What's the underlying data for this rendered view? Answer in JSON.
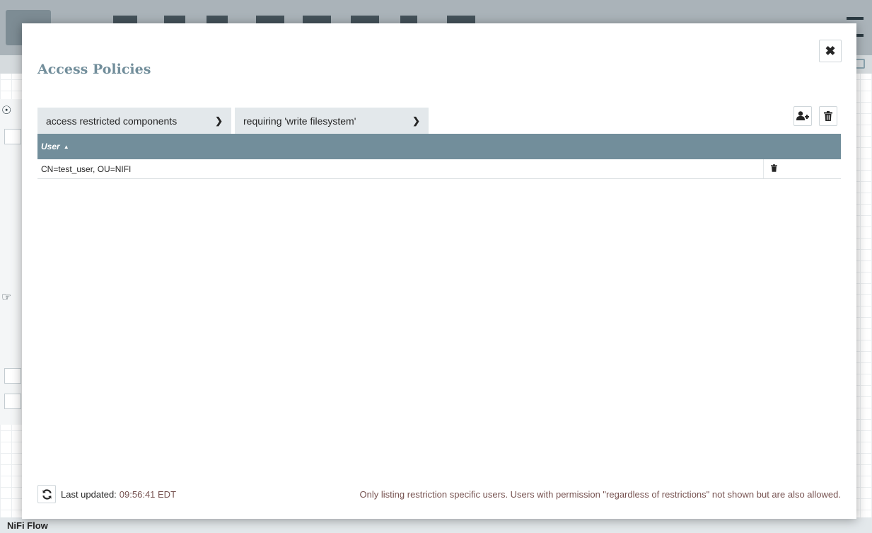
{
  "background_app": {
    "breadcrumb": "NiFi Flow"
  },
  "dialog": {
    "title": "Access Policies",
    "close_icon": "close-icon",
    "resource_select": {
      "value": "access restricted components"
    },
    "action_select": {
      "value": "requiring 'write filesystem'"
    },
    "toolbar": {
      "add_user_icon": "add-user-icon",
      "delete_policy_icon": "trash-icon"
    },
    "table": {
      "columns": [
        {
          "label": "User",
          "sort": "ascending"
        }
      ],
      "rows": [
        {
          "user": "CN=test_user, OU=NIFI",
          "action_icon": "trash-icon"
        }
      ]
    },
    "footer": {
      "refresh_icon": "refresh-icon",
      "last_updated_label": "Last updated:",
      "last_updated_value": "09:56:41 EDT",
      "restriction_message": "Only listing restriction specific users. Users with permission \"regardless of restrictions\" not shown but are also allowed."
    }
  },
  "colors": {
    "header_bg": "#728e9b",
    "title_text": "#728e9b",
    "combo_bg": "#e3e8eb",
    "timestamp_text": "#775351"
  }
}
